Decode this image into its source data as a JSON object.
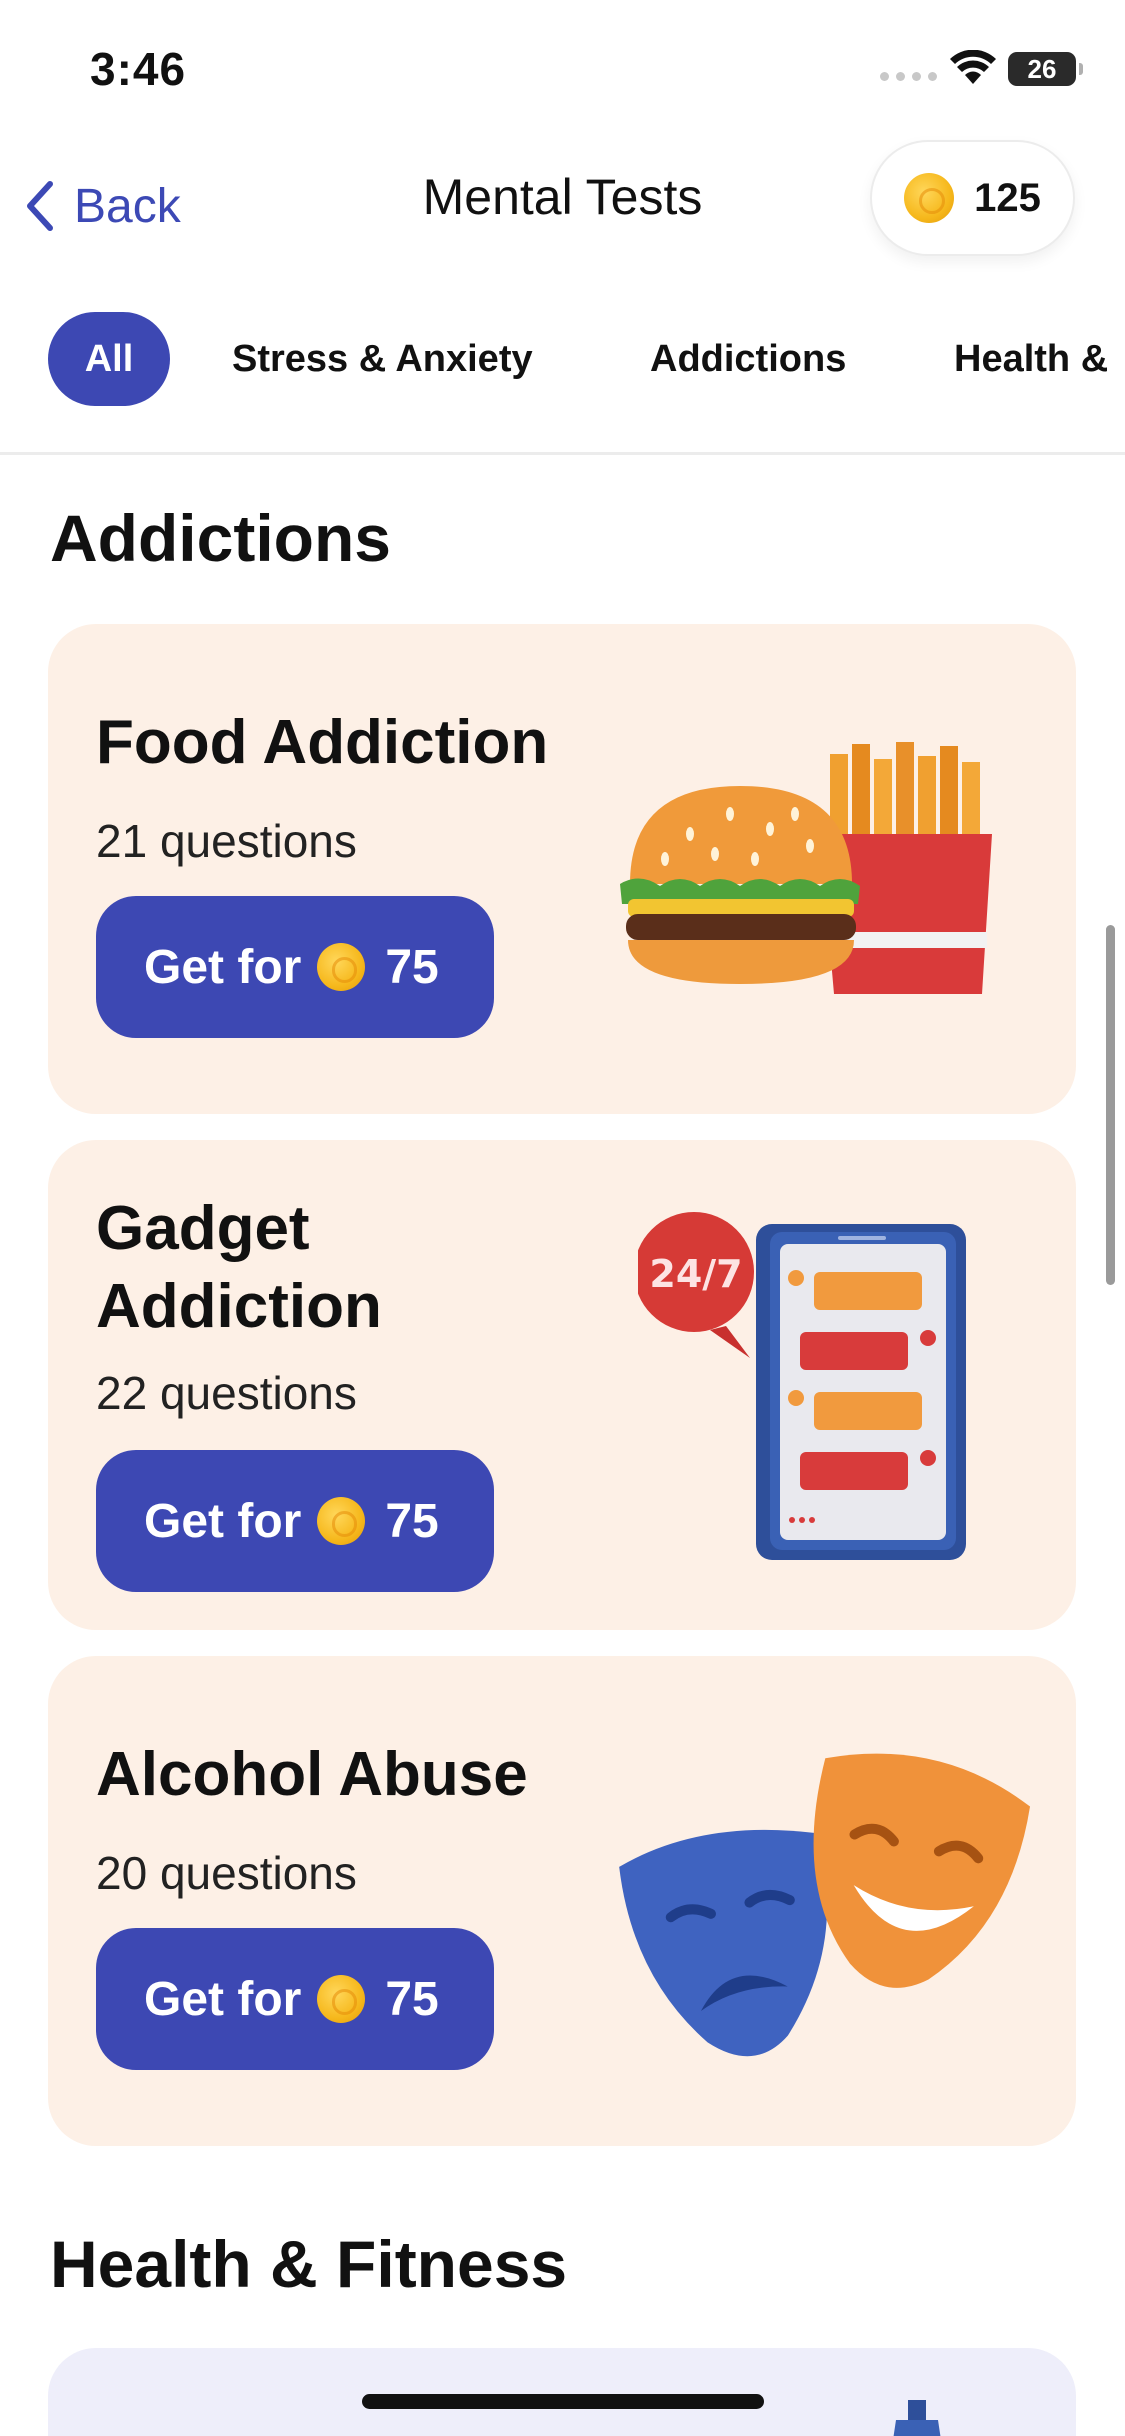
{
  "status_bar": {
    "time": "3:46",
    "battery": "26",
    "battery_level": 0.26
  },
  "nav": {
    "back_label": "Back",
    "title": "Mental Tests",
    "coins": "125"
  },
  "tabs": [
    {
      "label": "All",
      "active": true
    },
    {
      "label": "Stress & Anxiety",
      "active": false
    },
    {
      "label": "Addictions",
      "active": false
    },
    {
      "label": "Health &",
      "active": false
    }
  ],
  "sections": [
    {
      "title": "Addictions",
      "cards": [
        {
          "title": "Food Addiction",
          "questions": "21 questions",
          "button_label": "Get for",
          "price": "75",
          "icon": "burger-fries-icon"
        },
        {
          "title": "Gadget Addiction",
          "questions": "22 questions",
          "button_label": "Get for",
          "price": "75",
          "icon": "smartphone-chat-icon",
          "badge": "24/7"
        },
        {
          "title": "Alcohol Abuse",
          "questions": "20 questions",
          "button_label": "Get for",
          "price": "75",
          "icon": "theater-masks-icon"
        }
      ]
    },
    {
      "title": "Health & Fitness",
      "cards": []
    }
  ],
  "colors": {
    "accent": "#3d48b3",
    "card_bg": "#fdf0e6",
    "card_bg_blue": "#eeeefa",
    "link": "#3c49b5"
  }
}
